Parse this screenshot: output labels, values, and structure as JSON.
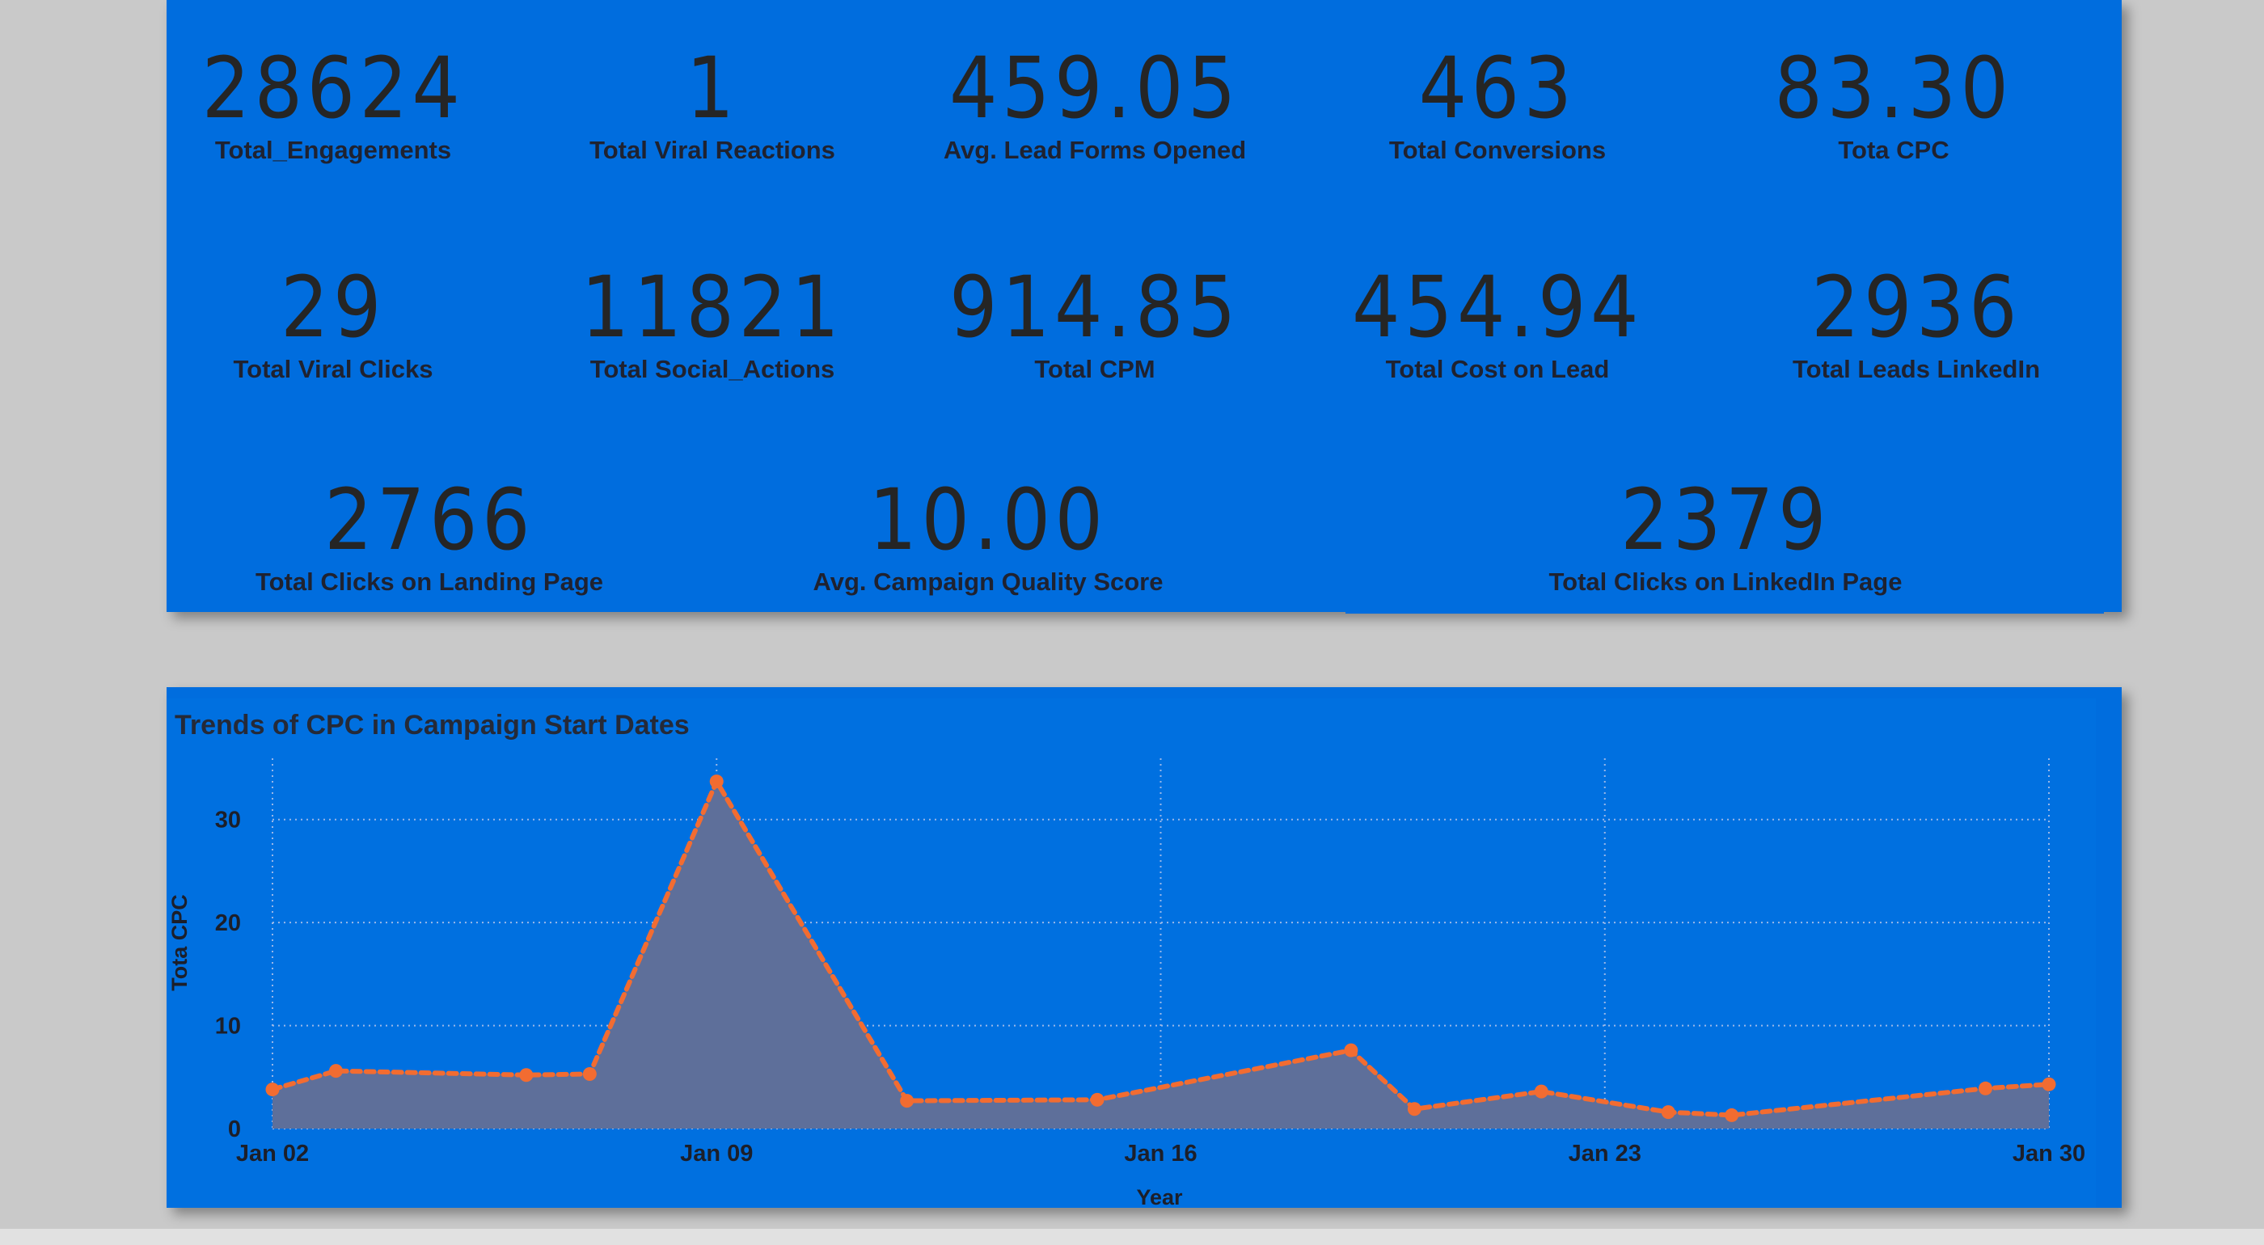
{
  "kpis": [
    {
      "value": "28624",
      "label": "Total_Engagements"
    },
    {
      "value": "1",
      "label": "Total Viral Reactions"
    },
    {
      "value": "459.05",
      "label": "Avg. Lead Forms Opened"
    },
    {
      "value": "463",
      "label": "Total Conversions"
    },
    {
      "value": "83.30",
      "label": "Tota CPC"
    },
    {
      "value": "29",
      "label": "Total Viral Clicks"
    },
    {
      "value": "11821",
      "label": "Total Social_Actions"
    },
    {
      "value": "914.85",
      "label": "Total CPM"
    },
    {
      "value": "454.94",
      "label": "Total Cost on Lead"
    },
    {
      "value": "2936",
      "label": "Total Leads LinkedIn"
    },
    {
      "value": "2766",
      "label": "Total Clicks on Landing Page"
    },
    {
      "value": "10.00",
      "label": "Avg. Campaign Quality Score"
    },
    {
      "value": "2379",
      "label": "Total Clicks on LinkedIn Page"
    }
  ],
  "colors": {
    "panel": "#006dde",
    "area_fill": "#5e6f9a",
    "line": "#f26c31",
    "grid": "#9ab8e8",
    "background": "#c9c9c9"
  },
  "chart_data": {
    "type": "area",
    "title": "Trends of CPC in Campaign Start Dates",
    "xlabel": "Year",
    "ylabel": "Tota CPC",
    "x_ticks": [
      "Jan 02",
      "Jan 09",
      "Jan 16",
      "Jan 23",
      "Jan 30"
    ],
    "y_ticks": [
      "0",
      "10",
      "20",
      "30"
    ],
    "ylim": [
      0,
      35
    ],
    "grid": true,
    "series": [
      {
        "x": [
          "2023-01-02",
          "2023-01-03",
          "2023-01-06",
          "2023-01-07",
          "2023-01-09",
          "2023-01-12",
          "2023-01-15",
          "2023-01-19",
          "2023-01-20",
          "2023-01-22",
          "2023-01-24",
          "2023-01-25",
          "2023-01-29",
          "2023-01-30"
        ],
        "values": [
          3.8,
          5.6,
          5.2,
          5.3,
          33.7,
          2.7,
          2.8,
          7.6,
          1.9,
          3.6,
          1.6,
          1.3,
          3.9,
          4.3
        ]
      }
    ]
  }
}
